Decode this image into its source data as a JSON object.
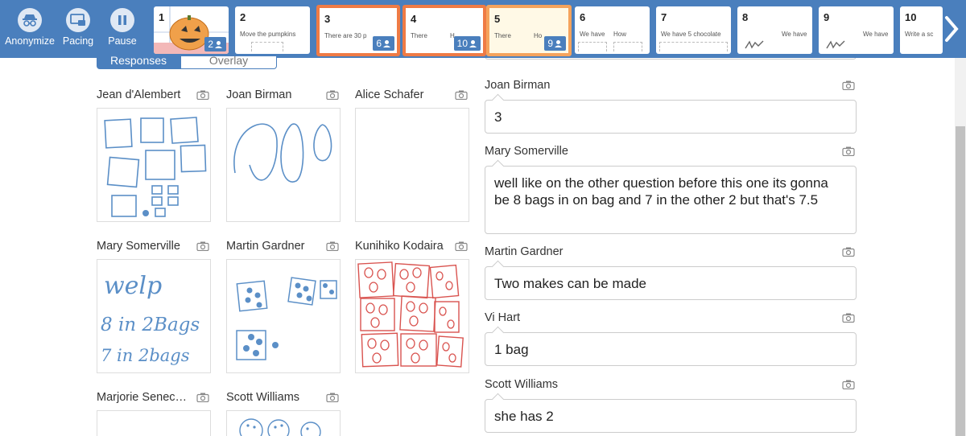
{
  "toolbar": {
    "anonymize_label": "Anonymize",
    "pacing_label": "Pacing",
    "pause_label": "Pause"
  },
  "screens": [
    {
      "num": "1",
      "title": "",
      "title2": "",
      "count": "2"
    },
    {
      "num": "2",
      "title": "Move the pumpkins",
      "title2": "",
      "count": ""
    },
    {
      "num": "3",
      "title": "There are 30 p",
      "title2": "",
      "count": "6"
    },
    {
      "num": "4",
      "title": "There",
      "title2": "H",
      "count": "10"
    },
    {
      "num": "5",
      "title": "There",
      "title2": "Ho",
      "count": "9"
    },
    {
      "num": "6",
      "title": "We have",
      "title2": "How",
      "count": ""
    },
    {
      "num": "7",
      "title": "We have 5 chocolate",
      "title2": "",
      "count": ""
    },
    {
      "num": "8",
      "title": "",
      "title2": "We have",
      "count": ""
    },
    {
      "num": "9",
      "title": "",
      "title2": "We have",
      "count": ""
    },
    {
      "num": "10",
      "title": "Write a sc",
      "title2": "",
      "count": ""
    }
  ],
  "tabs": {
    "responses": "Responses",
    "overlay": "Overlay"
  },
  "sketch_cards": [
    {
      "name": "Jean d'Alembert"
    },
    {
      "name": "Joan Birman"
    },
    {
      "name": "Alice Schafer"
    },
    {
      "name": "Mary Somerville"
    },
    {
      "name": "Martin Gardner"
    },
    {
      "name": "Kunihiko Kodaira"
    },
    {
      "name": "Marjorie Senec…"
    },
    {
      "name": "Scott Williams"
    }
  ],
  "sketch_text": {
    "line1": "welp",
    "line2": "8 in 2Bags",
    "line3": "7 in 2bags"
  },
  "responses": [
    {
      "name": "Joan Birman",
      "text": "3"
    },
    {
      "name": "Mary Somerville",
      "text": "well like on the other question before this one its gonna be 8 bags in on bag and 7 in the other 2 but that's 7.5"
    },
    {
      "name": "Martin Gardner",
      "text": "Two makes can be made"
    },
    {
      "name": "Vi Hart",
      "text": "1 bag"
    },
    {
      "name": "Scott Williams",
      "text": "she has 2"
    }
  ],
  "colors": {
    "toolbar": "#4a7fbd",
    "highlight": "#ef7b45",
    "sketch_blue": "#5b8fc7",
    "sketch_red": "#d9534f"
  }
}
